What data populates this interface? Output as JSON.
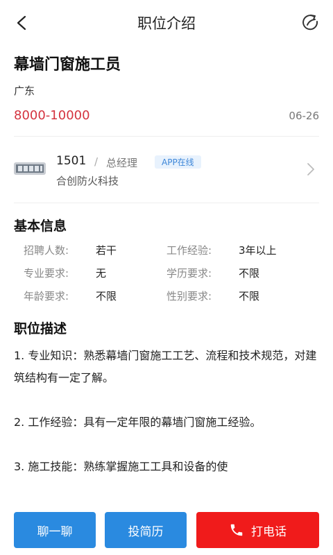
{
  "nav": {
    "title": "职位介绍"
  },
  "job": {
    "title": "幕墙门窗施工员",
    "city": "广东",
    "salary": "8000-10000",
    "date": "06-26"
  },
  "company": {
    "recruiter_name": "1501",
    "separator": "/",
    "recruiter_title": "总经理",
    "badge": "APP在线",
    "name": "合创防火科技"
  },
  "basic_info": {
    "title": "基本信息",
    "rows": [
      [
        {
          "label": "招聘人数:",
          "value": "若干"
        },
        {
          "label": "工作经验:",
          "value": "3年以上"
        }
      ],
      [
        {
          "label": "专业要求:",
          "value": "无"
        },
        {
          "label": "学历要求:",
          "value": "不限"
        }
      ],
      [
        {
          "label": "年龄要求:",
          "value": "不限"
        },
        {
          "label": "性别要求:",
          "value": "不限"
        }
      ]
    ]
  },
  "description": {
    "title": "职位描述",
    "paragraphs": [
      "1. 专业知识：熟悉幕墙门窗施工工艺、流程和技术规范，对建筑结构有一定了解。",
      "2. 工作经验：具有一定年限的幕墙门窗施工经验。",
      "3. 施工技能：熟练掌握施工工具和设备的使"
    ]
  },
  "actions": {
    "chat": "聊一聊",
    "resume": "投简历",
    "call": "打电话"
  },
  "colors": {
    "salary": "#d4333f",
    "primary_button": "#2a8ae0",
    "call_button": "#f01b1b",
    "badge_text": "#3d86d8"
  }
}
